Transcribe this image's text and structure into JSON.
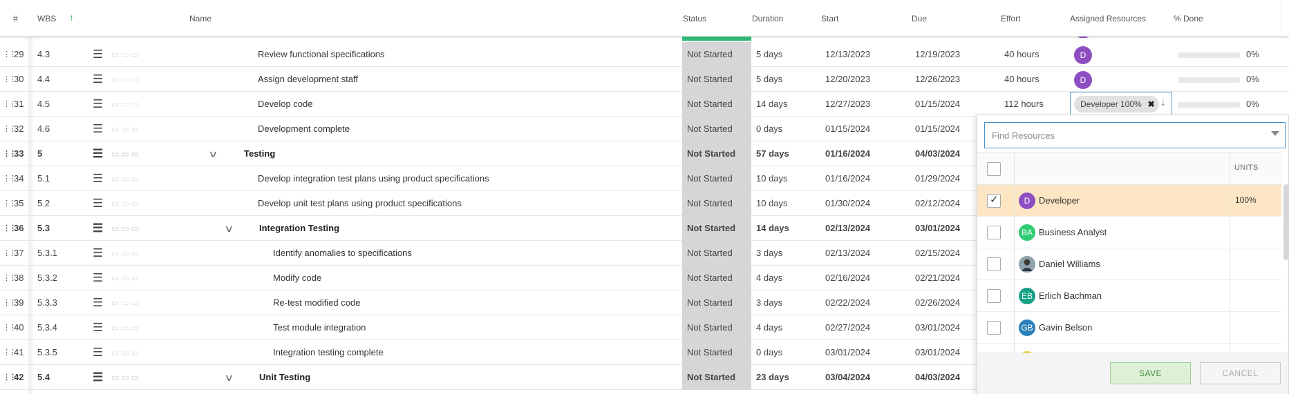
{
  "header": {
    "num": "#",
    "wbs": "WBS",
    "name": "Name",
    "status": "Status",
    "duration": "Duration",
    "start": "Start",
    "due": "Due",
    "effort": "Effort",
    "assigned": "Assigned Resources",
    "done": "% Done"
  },
  "rows": [
    {
      "num": "29",
      "wbs": "4.3",
      "name": "Review functional specifications",
      "status": "Not Started",
      "duration": "5 days",
      "start": "12/13/2023",
      "due": "12/19/2023",
      "effort": "40 hours",
      "avatar": "D",
      "pct": "0%"
    },
    {
      "num": "30",
      "wbs": "4.4",
      "name": "Assign development staff",
      "status": "Not Started",
      "duration": "5 days",
      "start": "12/20/2023",
      "due": "12/26/2023",
      "effort": "40 hours",
      "avatar": "D",
      "pct": "0%"
    },
    {
      "num": "31",
      "wbs": "4.5",
      "name": "Develop code",
      "status": "Not Started",
      "duration": "14 days",
      "start": "12/27/2023",
      "due": "01/15/2024",
      "effort": "112 hours",
      "pct": "0%"
    },
    {
      "num": "32",
      "wbs": "4.6",
      "name": "Development complete",
      "status": "Not Started",
      "duration": "0 days",
      "start": "01/15/2024",
      "due": "01/15/2024"
    },
    {
      "num": "33",
      "wbs": "5",
      "name": "Testing",
      "status": "Not Started",
      "duration": "57 days",
      "start": "01/16/2024",
      "due": "04/03/2024"
    },
    {
      "num": "34",
      "wbs": "5.1",
      "name": "Develop integration test plans using product specifications",
      "status": "Not Started",
      "duration": "10 days",
      "start": "01/16/2024",
      "due": "01/29/2024"
    },
    {
      "num": "35",
      "wbs": "5.2",
      "name": "Develop unit test plans using product specifications",
      "status": "Not Started",
      "duration": "10 days",
      "start": "01/30/2024",
      "due": "02/12/2024"
    },
    {
      "num": "36",
      "wbs": "5.3",
      "name": "Integration Testing",
      "status": "Not Started",
      "duration": "14 days",
      "start": "02/13/2024",
      "due": "03/01/2024"
    },
    {
      "num": "37",
      "wbs": "5.3.1",
      "name": "Identify anomalies to specifications",
      "status": "Not Started",
      "duration": "3 days",
      "start": "02/13/2024",
      "due": "02/15/2024"
    },
    {
      "num": "38",
      "wbs": "5.3.2",
      "name": "Modify code",
      "status": "Not Started",
      "duration": "4 days",
      "start": "02/16/2024",
      "due": "02/21/2024"
    },
    {
      "num": "39",
      "wbs": "5.3.3",
      "name": "Re-test modified code",
      "status": "Not Started",
      "duration": "3 days",
      "start": "02/22/2024",
      "due": "02/26/2024"
    },
    {
      "num": "40",
      "wbs": "5.3.4",
      "name": "Test module integration",
      "status": "Not Started",
      "duration": "4 days",
      "start": "02/27/2024",
      "due": "03/01/2024"
    },
    {
      "num": "41",
      "wbs": "5.3.5",
      "name": "Integration testing complete",
      "status": "Not Started",
      "duration": "0 days",
      "start": "03/01/2024",
      "due": "03/01/2024"
    },
    {
      "num": "42",
      "wbs": "5.4",
      "name": "Unit Testing",
      "status": "Not Started",
      "duration": "23 days",
      "start": "03/04/2024",
      "due": "04/03/2024"
    }
  ],
  "resource_editor": {
    "chip_label": "Developer 100%"
  },
  "resource_panel": {
    "search_placeholder": "Find Resources",
    "units_header": "UNITS",
    "items": [
      {
        "initials": "D",
        "name": "Developer",
        "units": "100%",
        "checked": true,
        "color": "#8e4dc1"
      },
      {
        "initials": "BA",
        "name": "Business Analyst",
        "units": "",
        "checked": false,
        "color": "#2ecc71"
      },
      {
        "initials": "",
        "name": "Daniel Williams",
        "units": "",
        "checked": false,
        "color": "#6b7b86"
      },
      {
        "initials": "EB",
        "name": "Erlich Bachman",
        "units": "",
        "checked": false,
        "color": "#16a085"
      },
      {
        "initials": "GB",
        "name": "Gavin Belson",
        "units": "",
        "checked": false,
        "color": "#2a80b9"
      }
    ],
    "save_label": "SAVE",
    "cancel_label": "CANCEL"
  },
  "colors": {
    "status_accent": "#2db674",
    "avatar_developer": "#8e4dc1",
    "selected_row": "#fde6c4",
    "focus_border": "#4e97d1"
  }
}
